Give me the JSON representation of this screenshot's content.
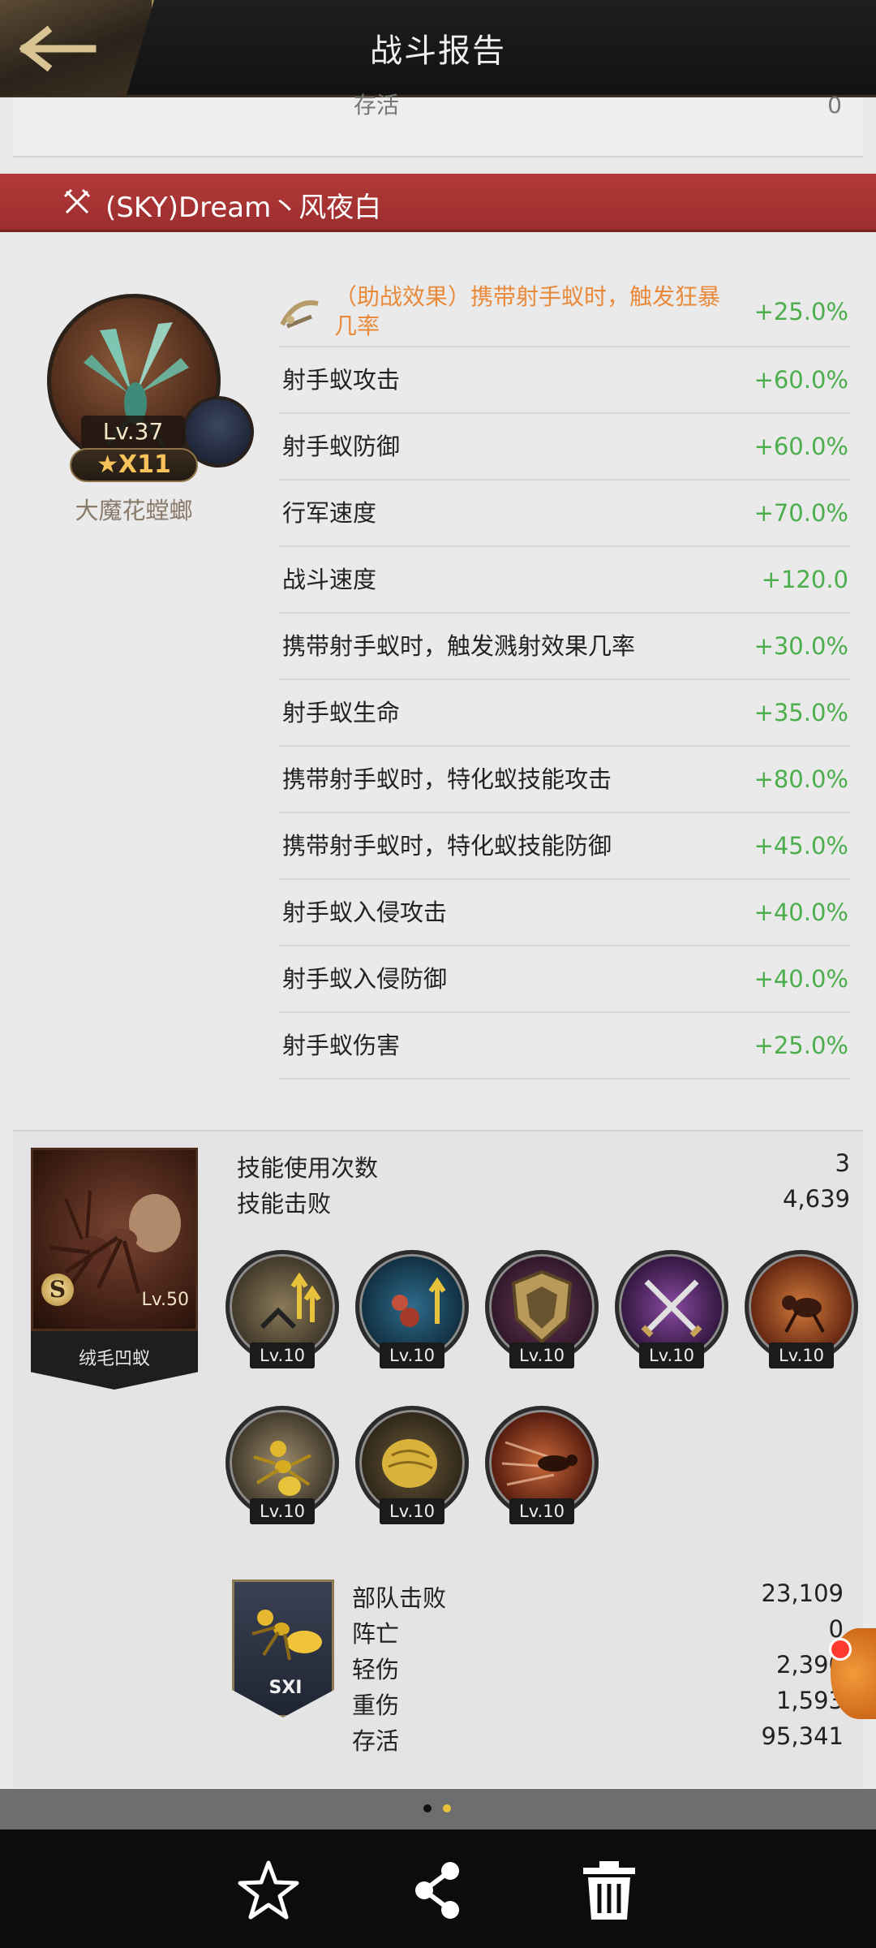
{
  "header": {
    "title": "战斗报告"
  },
  "prev_card": {
    "label": "存活",
    "value": "0"
  },
  "player": {
    "name": "(SKY)Dream丶风夜白"
  },
  "hero": {
    "level": "Lv.37",
    "stars": "★X11",
    "name": "大魔花螳螂"
  },
  "stats": [
    {
      "label": "（助战效果）携带射手蚁时，触发狂暴几率",
      "value": "+25.0%",
      "assist": true
    },
    {
      "label": "射手蚁攻击",
      "value": "+60.0%"
    },
    {
      "label": "射手蚁防御",
      "value": "+60.0%"
    },
    {
      "label": "行军速度",
      "value": "+70.0%"
    },
    {
      "label": "战斗速度",
      "value": "+120.0"
    },
    {
      "label": "携带射手蚁时，触发溅射效果几率",
      "value": "+30.0%"
    },
    {
      "label": "射手蚁生命",
      "value": "+35.0%"
    },
    {
      "label": "携带射手蚁时，特化蚁技能攻击",
      "value": "+80.0%"
    },
    {
      "label": "携带射手蚁时，特化蚁技能防御",
      "value": "+45.0%"
    },
    {
      "label": "射手蚁入侵攻击",
      "value": "+40.0%"
    },
    {
      "label": "射手蚁入侵防御",
      "value": "+40.0%"
    },
    {
      "label": "射手蚁伤害",
      "value": "+25.0%"
    }
  ],
  "ant": {
    "badge": "S",
    "level": "Lv.50",
    "name": "绒毛凹蚁",
    "skill_uses_label": "技能使用次数",
    "skill_uses_value": "3",
    "skill_kills_label": "技能击败",
    "skill_kills_value": "4,639",
    "skills": [
      {
        "icon": "ant-attack-up-icon",
        "level": "Lv.10"
      },
      {
        "icon": "ant-team-up-icon",
        "level": "Lv.10"
      },
      {
        "icon": "shield-icon",
        "level": "Lv.10"
      },
      {
        "icon": "crossed-swords-icon",
        "level": "Lv.10"
      },
      {
        "icon": "ant-strike-icon",
        "level": "Lv.10"
      },
      {
        "icon": "golden-ant-icon",
        "level": "Lv.10"
      },
      {
        "icon": "ant-abdomen-icon",
        "level": "Lv.10"
      },
      {
        "icon": "ant-dash-icon",
        "level": "Lv.10"
      }
    ]
  },
  "troop": {
    "tag": "SXI",
    "rows": [
      {
        "label": "部队击败",
        "value": "23,109"
      },
      {
        "label": "阵亡",
        "value": "0"
      },
      {
        "label": "轻伤",
        "value": "2,390"
      },
      {
        "label": "重伤",
        "value": "1,593"
      },
      {
        "label": "存活",
        "value": "95,341"
      }
    ]
  },
  "colors": {
    "accent_red": "#b33a3a",
    "positive_green": "#4cae4c",
    "assist_orange": "#e98a3b"
  }
}
